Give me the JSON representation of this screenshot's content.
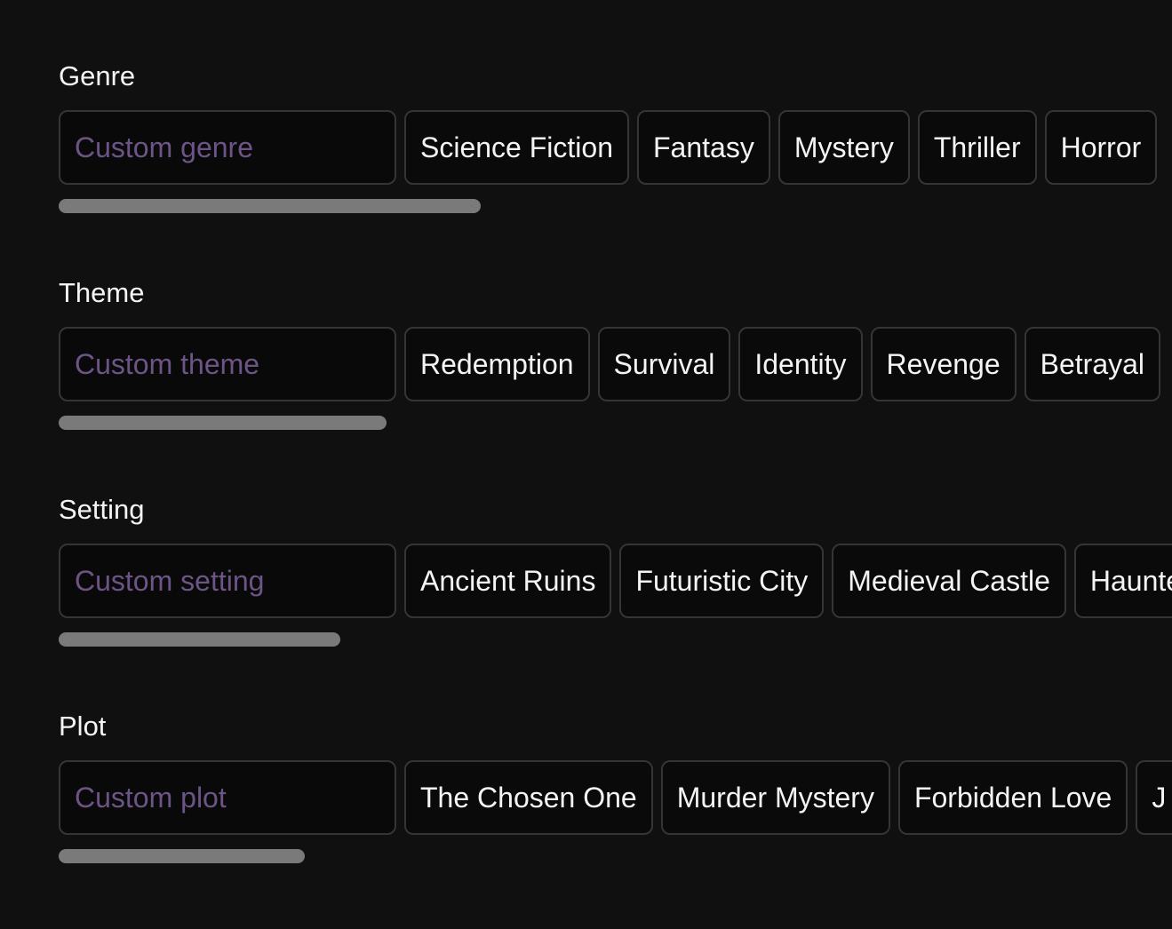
{
  "sections": [
    {
      "id": "genre",
      "label": "Genre",
      "placeholder": "Custom genre",
      "options": [
        "Science Fiction",
        "Fantasy",
        "Mystery",
        "Thriller",
        "Horror"
      ],
      "scroll_fraction": 0.36
    },
    {
      "id": "theme",
      "label": "Theme",
      "placeholder": "Custom theme",
      "options": [
        "Redemption",
        "Survival",
        "Identity",
        "Revenge",
        "Betrayal"
      ],
      "scroll_fraction": 0.28
    },
    {
      "id": "setting",
      "label": "Setting",
      "placeholder": "Custom setting",
      "options": [
        "Ancient Ruins",
        "Futuristic City",
        "Medieval Castle",
        "Haunte"
      ],
      "scroll_fraction": 0.24
    },
    {
      "id": "plot",
      "label": "Plot",
      "placeholder": "Custom plot",
      "options": [
        "The Chosen One",
        "Murder Mystery",
        "Forbidden Love",
        "J"
      ],
      "scroll_fraction": 0.21
    }
  ]
}
